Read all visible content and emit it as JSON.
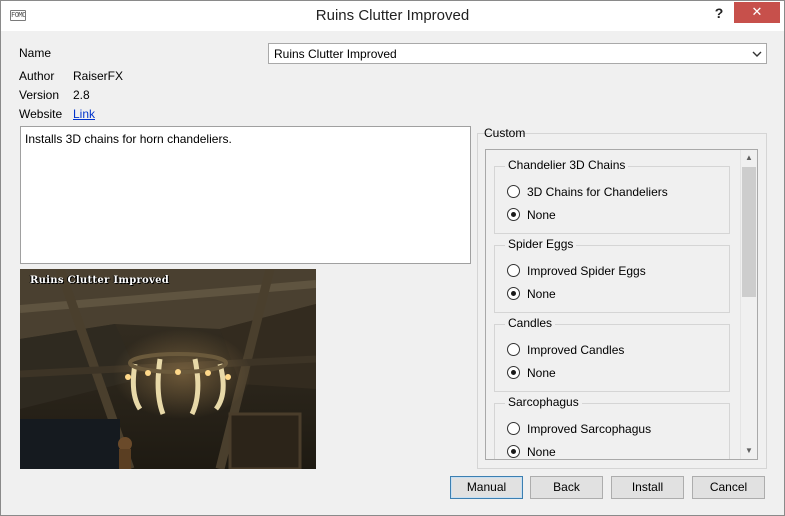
{
  "window": {
    "title": "Ruins Clutter Improved",
    "icon_text": "FOMOD",
    "help_label": "?",
    "close_label": "✕"
  },
  "info": {
    "name_label": "Name",
    "name_value": "Ruins Clutter Improved",
    "author_label": "Author",
    "author_value": "RaiserFX",
    "version_label": "Version",
    "version_value": "2.8",
    "website_label": "Website",
    "website_link": "Link"
  },
  "description": "Installs 3D chains for horn chandeliers.",
  "preview": {
    "overlay_text": "Ruins Clutter Improved"
  },
  "custom": {
    "label": "Custom",
    "groups": [
      {
        "title": "Chandelier 3D Chains",
        "options": [
          {
            "label": "3D Chains for Chandeliers",
            "selected": false
          },
          {
            "label": "None",
            "selected": true
          }
        ]
      },
      {
        "title": "Spider Eggs",
        "options": [
          {
            "label": "Improved Spider Eggs",
            "selected": false
          },
          {
            "label": "None",
            "selected": true
          }
        ]
      },
      {
        "title": "Candles",
        "options": [
          {
            "label": "Improved Candles",
            "selected": false
          },
          {
            "label": "None",
            "selected": true
          }
        ]
      },
      {
        "title": "Sarcophagus",
        "options": [
          {
            "label": "Improved Sarcophagus",
            "selected": false
          },
          {
            "label": "None",
            "selected": true
          }
        ]
      }
    ]
  },
  "buttons": {
    "manual": "Manual",
    "back": "Back",
    "install": "Install",
    "cancel": "Cancel"
  },
  "colors": {
    "close_button": "#c7504b",
    "link": "#0033cc",
    "window_bg": "#f0f0f0"
  }
}
